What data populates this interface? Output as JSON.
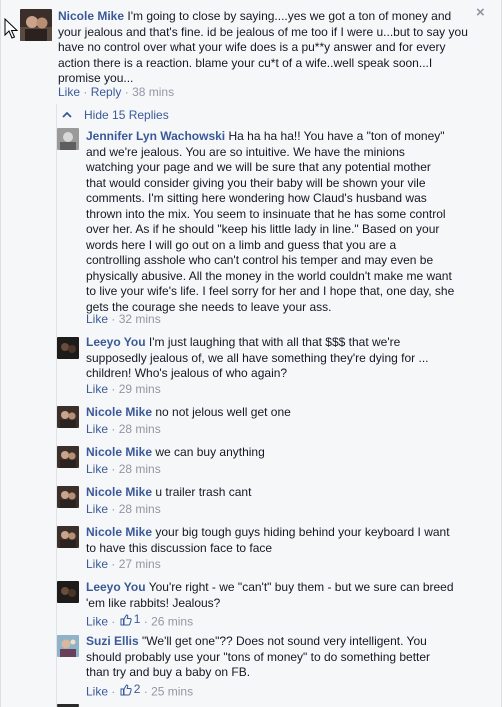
{
  "top_comment": {
    "author": "Nicole Mike",
    "text_lines": [
      "I'm going to close by saying....yes we got a ton of money and",
      "your jealous and that's fine. id be jealous of me too if I were u...but to say you",
      "have no control over what your wife does is a pu**y answer and for every",
      "action there is a reaction. blame your cu*t of a wife..well speak soon...I",
      "promise you..."
    ],
    "like_label": "Like",
    "reply_label": "Reply",
    "time": "38 mins"
  },
  "close_icon": "×",
  "hide_replies_label": "Hide 15 Replies",
  "replies": [
    {
      "author": "Jennifer Lyn Wachowski",
      "text_lines": [
        "Ha ha ha ha!! You have a \"ton of money\"",
        "and we're jealous. You are so intuitive. We have the minions",
        "watching your page and we will be sure that any potential mother",
        "that would consider giving you their baby will be shown your vile",
        "comments. I'm sitting here wondering how Claud's husband was",
        "thrown into the mix. You seem to insinuate that he has some control",
        "over her. As if he should \"keep his little lady in line.\" Based on your",
        "words here I will go out on a limb and guess that you are a",
        "controlling asshole who can't control his temper and may even be",
        "physically abusive. All the money in the world couldn't make me want",
        "to live your wife's life. I feel sorry for her and I hope that, one day, she",
        "gets the courage she needs to leave your ass."
      ],
      "like_label": "Like",
      "likes": "",
      "time": "32 mins"
    },
    {
      "author": "Leeyo You",
      "text_lines": [
        "I'm just laughing that with all that $$$ that we're",
        "supposedly jealous of, we all have something they're dying for ...",
        "children! Who's jealous of who again?"
      ],
      "like_label": "Like",
      "likes": "",
      "time": "29 mins"
    },
    {
      "author": "Nicole Mike",
      "text_lines": [
        "no not jelous well get one"
      ],
      "like_label": "Like",
      "likes": "",
      "time": "28 mins"
    },
    {
      "author": "Nicole Mike",
      "text_lines": [
        "we can buy anything"
      ],
      "like_label": "Like",
      "likes": "",
      "time": "28 mins"
    },
    {
      "author": "Nicole Mike",
      "text_lines": [
        "u trailer trash cant"
      ],
      "like_label": "Like",
      "likes": "",
      "time": "28 mins"
    },
    {
      "author": "Nicole Mike",
      "text_lines": [
        "your big tough guys hiding behind your keyboard I want",
        "to have this discussion face to face"
      ],
      "like_label": "Like",
      "likes": "",
      "time": "27 mins"
    },
    {
      "author": "Leeyo You",
      "text_lines": [
        "You're right - we \"can't\" buy them - but we sure can breed",
        "'em like rabbits! Jealous?"
      ],
      "like_label": "Like",
      "likes": "1",
      "time": "26 mins"
    },
    {
      "author": "Suzi Ellis",
      "text_lines": [
        "\"We'll get one\"?? Does not sound very intelligent. You",
        "should probably use your \"tons of money\" to do something better",
        "than try and buy a baby on FB."
      ],
      "like_label": "Like",
      "likes": "2",
      "time": "25 mins"
    }
  ],
  "colors": {
    "link": "#3b5998",
    "meta": "#9197a3",
    "text": "#141823",
    "background": "#f6f7f9"
  }
}
